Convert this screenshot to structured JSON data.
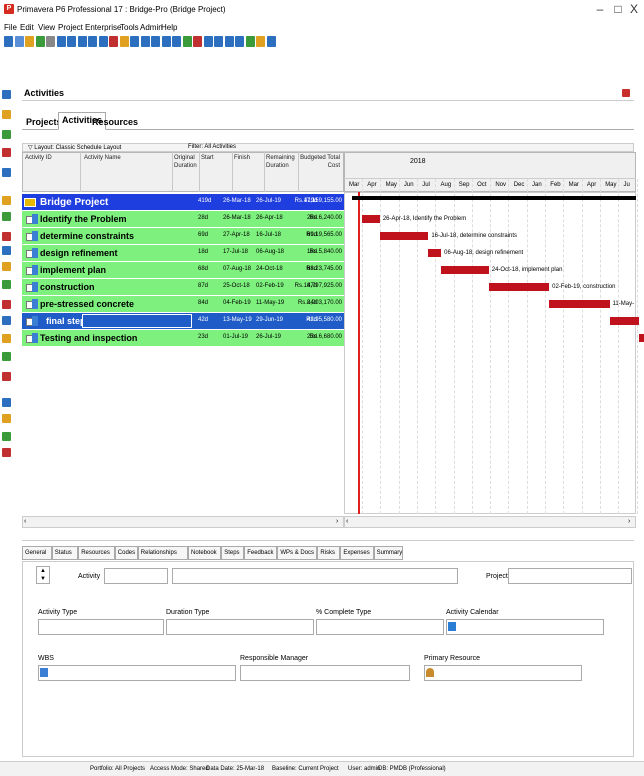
{
  "window": {
    "title": "Primavera P6 Professional 17 : Bridge-Pro (Bridge Project)",
    "icon": "P",
    "min": "–",
    "max": "□",
    "close": "X"
  },
  "menu": [
    "File",
    "Edit",
    "View",
    "Project",
    "Enterprise",
    "Tools",
    "Admin",
    "Help"
  ],
  "pane": {
    "title": "Activities"
  },
  "tabs": [
    "Projects",
    "Activities",
    "Resources"
  ],
  "layout_label": "▽ Layout: Classic Schedule Layout",
  "filter_label": "Filter: All Activities",
  "columns": {
    "id": "Activity ID",
    "name": "Activity Name",
    "od": "Original Duration",
    "start": "Start",
    "finish": "Finish",
    "rd": "Remaining Duration",
    "cost": "Budgeted Total Cost"
  },
  "project": {
    "name": "Bridge Project",
    "od": "419d",
    "start": "26-Mar-18",
    "finish": "26-Jul-19",
    "rd": "419d",
    "cost": "Rs.17,159,155.00"
  },
  "activities": [
    {
      "name": "Identify the Problem",
      "od": "28d",
      "start": "26-Mar-18",
      "finish": "26-Apr-18",
      "rd": "28d",
      "cost": "Rs.6,240.00",
      "label": "26-Apr-18, Identify the Problem"
    },
    {
      "name": "determine constraints",
      "od": "69d",
      "start": "27-Apr-18",
      "finish": "16-Jul-18",
      "rd": "69d",
      "cost": "Rs.19,565.00",
      "label": "16-Jul-18, determine constraints"
    },
    {
      "name": "design refinement",
      "od": "18d",
      "start": "17-Jul-18",
      "finish": "06-Aug-18",
      "rd": "18d",
      "cost": "Rs.5,840.00",
      "label": "06-Aug-18, design refinement"
    },
    {
      "name": "implement plan",
      "od": "68d",
      "start": "07-Aug-18",
      "finish": "24-Oct-18",
      "rd": "68d",
      "cost": "Rs.23,745.00",
      "label": "24-Oct-18, implement plan"
    },
    {
      "name": "construction",
      "od": "87d",
      "start": "25-Oct-18",
      "finish": "02-Feb-19",
      "rd": "87d",
      "cost": "Rs.14,797,925.00",
      "label": "02-Feb-19, construction"
    },
    {
      "name": "pre-stressed concrete",
      "od": "84d",
      "start": "04-Feb-19",
      "finish": "11-May-19",
      "rd": "84d",
      "cost": "Rs.2,203,170.00",
      "label": "11-May-"
    },
    {
      "name": "final step",
      "od": "42d",
      "start": "13-May-19",
      "finish": "29-Jun-19",
      "rd": "42d",
      "cost": "Rs.95,580.00",
      "label": ""
    },
    {
      "name": "Testing and inspection",
      "od": "23d",
      "start": "01-Jul-19",
      "finish": "26-Jul-19",
      "rd": "23d",
      "cost": "Rs.6,680.00",
      "label": ""
    }
  ],
  "gantt": {
    "year": "2018",
    "months": [
      "Mar",
      "Apr",
      "May",
      "Jun",
      "Jul",
      "Aug",
      "Sep",
      "Oct",
      "Nov",
      "Dec",
      "Jan",
      "Feb",
      "Mar",
      "Apr",
      "May",
      "Ju"
    ]
  },
  "details_tabs": [
    "General",
    "Status",
    "Resources",
    "Codes",
    "Relationships",
    "Notebook",
    "Steps",
    "Feedback",
    "WPs & Docs",
    "Risks",
    "Expenses",
    "Summary"
  ],
  "details": {
    "activity": "Activity",
    "project": "Project",
    "activity_type": "Activity Type",
    "duration_type": "Duration Type",
    "pct_type": "% Complete Type",
    "calendar": "Activity Calendar",
    "wbs": "WBS",
    "manager": "Responsible Manager",
    "resource": "Primary Resource"
  },
  "status": {
    "portfolio": "Portfolio: All Projects",
    "access": "Access Mode: Shared",
    "data_date": "Data Date: 25-Mar-18",
    "baseline": "Baseline: Current Project",
    "user": "User: admin",
    "db": "DB: PMDB (Professional)"
  },
  "colors": {
    "bar": "#c0121c",
    "row_green": "#7df07d",
    "row_selected": "#1f5cc8",
    "project_row": "#1f3ee0"
  }
}
